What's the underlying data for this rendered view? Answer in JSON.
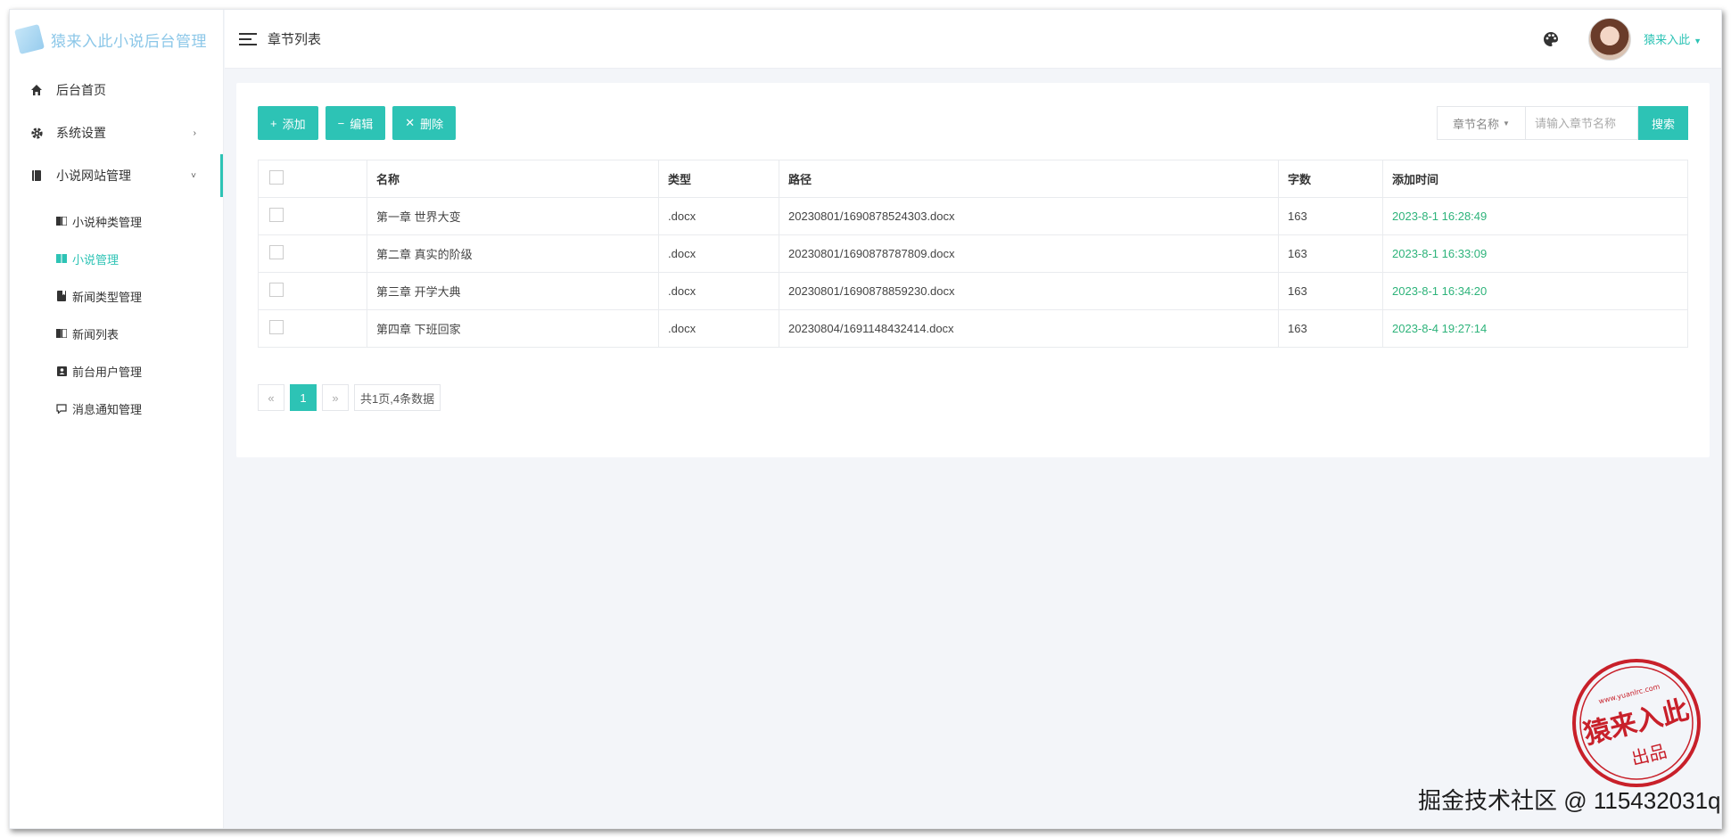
{
  "app": {
    "title": "猿来入此小说后台管理"
  },
  "header": {
    "page_title": "章节列表",
    "username": "猿来入此"
  },
  "sidebar": {
    "items": [
      {
        "label": "后台首页",
        "icon": "home-icon"
      },
      {
        "label": "系统设置",
        "icon": "gear-icon"
      },
      {
        "label": "小说网站管理",
        "icon": "book-icon"
      }
    ],
    "subitems": [
      {
        "label": "小说种类管理",
        "icon": "book-open-icon"
      },
      {
        "label": "小说管理",
        "icon": "book-open-icon"
      },
      {
        "label": "新闻类型管理",
        "icon": "bookmark-icon"
      },
      {
        "label": "新闻列表",
        "icon": "book-open-icon"
      },
      {
        "label": "前台用户管理",
        "icon": "user-card-icon"
      },
      {
        "label": "消息通知管理",
        "icon": "comment-icon"
      }
    ]
  },
  "toolbar": {
    "add": "添加",
    "edit": "编辑",
    "delete": "删除"
  },
  "search": {
    "field": "章节名称",
    "placeholder": "请输入章节名称",
    "button": "搜索"
  },
  "table": {
    "headers": [
      "名称",
      "类型",
      "路径",
      "字数",
      "添加时间"
    ],
    "rows": [
      {
        "name": "第一章 世界大变",
        "type": ".docx",
        "path": "20230801/1690878524303.docx",
        "words": "163",
        "time": "2023-8-1 16:28:49"
      },
      {
        "name": "第二章 真实的阶级",
        "type": ".docx",
        "path": "20230801/1690878787809.docx",
        "words": "163",
        "time": "2023-8-1 16:33:09"
      },
      {
        "name": "第三章 开学大典",
        "type": ".docx",
        "path": "20230801/1690878859230.docx",
        "words": "163",
        "time": "2023-8-1 16:34:20"
      },
      {
        "name": "第四章 下班回家",
        "type": ".docx",
        "path": "20230804/1691148432414.docx",
        "words": "163",
        "time": "2023-8-4 19:27:14"
      }
    ]
  },
  "pagination": {
    "prev": "«",
    "current": "1",
    "next": "»",
    "info": "共1页,4条数据"
  },
  "stamp": {
    "text": "猿来入此",
    "sub": "出品",
    "url": "www.yuanlrc.com"
  },
  "watermark": {
    "text": "掘金技术社区 @ 115432031q"
  },
  "colors": {
    "accent": "#2dc3b5",
    "time": "#2db37a",
    "stamp": "#c8202a"
  }
}
